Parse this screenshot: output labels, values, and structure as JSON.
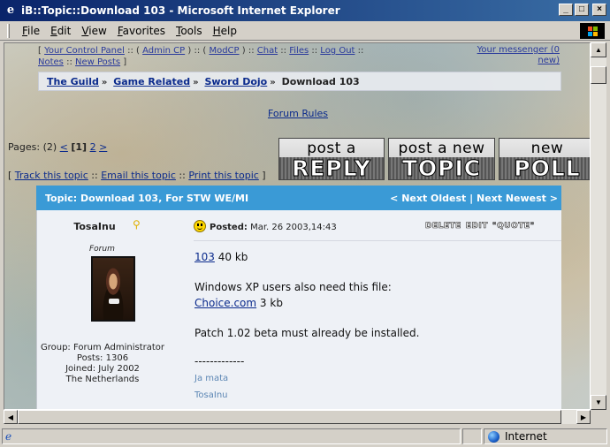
{
  "window": {
    "title": "iB::Topic::Download 103 - Microsoft Internet Explorer",
    "app_icon": "e"
  },
  "menu": [
    "File",
    "Edit",
    "View",
    "Favorites",
    "Tools",
    "Help"
  ],
  "top_nav": {
    "links": [
      "Your Control Panel",
      "Admin CP",
      "ModCP",
      "Chat",
      "Files",
      "Log Out",
      "Notes",
      "New Posts"
    ],
    "messenger": "Your messenger (",
    "messenger_count": "0",
    "messenger_new": "new)"
  },
  "breadcrumb": [
    "The Guild",
    "Game Related",
    "Sword Dojo",
    "Download 103"
  ],
  "forum_rules": "Forum Rules",
  "pagination": {
    "label": "Pages: (2)",
    "prev": "<",
    "current": "[1]",
    "next_page": "2",
    "next": ">"
  },
  "buttons": {
    "reply_small": "post a",
    "reply_big": "REPLY",
    "topic_small": "post a new",
    "topic_big": "TOPIC",
    "poll_small": "new",
    "poll_big": "POLL"
  },
  "topic_links": [
    "Track this topic",
    "Email this topic",
    "Print this topic"
  ],
  "topic": {
    "title": "Topic: Download 103, For STW WE/MI",
    "next_oldest": "Next Oldest",
    "next_newest": "Next Newest"
  },
  "post": {
    "author": "TosaInu",
    "role": "Forum",
    "group": "Group: Forum Administrator",
    "posts": "Posts: 1306",
    "joined": "Joined: July 2002",
    "location": "The Netherlands",
    "posted_label": "Posted:",
    "posted_date": "Mar. 26 2003,14:43",
    "actions": [
      "DELETE",
      "EDIT",
      "\"QUOTE\""
    ],
    "file1_link": "103",
    "file1_size": "40 kb",
    "xp_note": "Windows XP users also need this file:",
    "file2_link": "Choice.com",
    "file2_size": "3 kb",
    "patch_note": "Patch 1.02 beta must already be installed.",
    "separator": "-------------",
    "sig1": "Ja mata",
    "sig2": "TosaInu"
  },
  "status": {
    "zone": "Internet"
  }
}
